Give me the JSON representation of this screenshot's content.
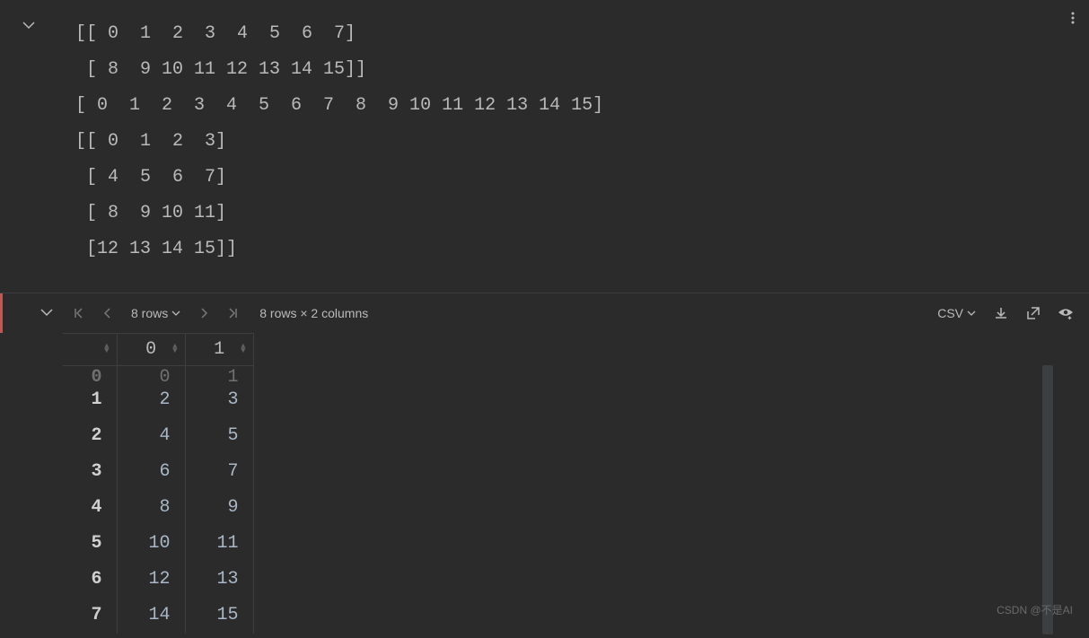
{
  "output": {
    "lines": [
      "[[ 0  1  2  3  4  5  6  7]",
      " [ 8  9 10 11 12 13 14 15]]",
      "[ 0  1  2  3  4  5  6  7  8  9 10 11 12 13 14 15]",
      "[[ 0  1  2  3]",
      " [ 4  5  6  7]",
      " [ 8  9 10 11]",
      " [12 13 14 15]]"
    ]
  },
  "table_viewer": {
    "rows_label": "8 rows",
    "dimensions": "8 rows × 2 columns",
    "export_format": "CSV",
    "columns": [
      "0",
      "1"
    ],
    "partial_row": {
      "index": "0",
      "values": [
        "0",
        "1"
      ]
    },
    "rows": [
      {
        "index": "1",
        "values": [
          "2",
          "3"
        ]
      },
      {
        "index": "2",
        "values": [
          "4",
          "5"
        ]
      },
      {
        "index": "3",
        "values": [
          "6",
          "7"
        ]
      },
      {
        "index": "4",
        "values": [
          "8",
          "9"
        ]
      },
      {
        "index": "5",
        "values": [
          "10",
          "11"
        ]
      },
      {
        "index": "6",
        "values": [
          "12",
          "13"
        ]
      },
      {
        "index": "7",
        "values": [
          "14",
          "15"
        ]
      }
    ]
  },
  "watermark": "CSDN @不是AI"
}
